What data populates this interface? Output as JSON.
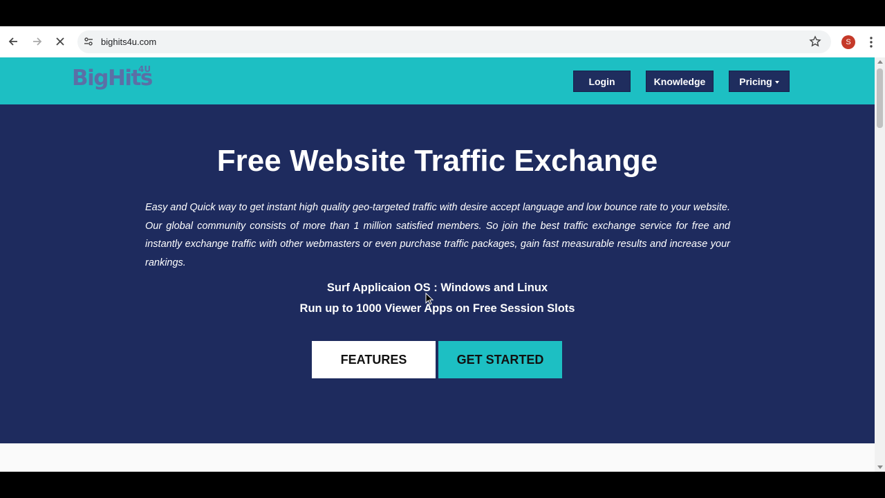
{
  "browser": {
    "url": "bighits4u.com",
    "avatar_letter": "S",
    "avatar_color": "#c53929"
  },
  "site": {
    "logo_text": "BigHits",
    "logo_suffix": "4U",
    "nav": {
      "login": "Login",
      "knowledge": "Knowledge",
      "pricing": "Pricing"
    }
  },
  "hero": {
    "title": "Free Website Traffic Exchange",
    "description": "Easy and Quick way to get instant high quality geo-targeted traffic with desire accept language and low bounce rate to your website. Our global community consists of more than 1 million satisfied members. So join the best traffic exchange service for free and instantly exchange traffic with other webmasters or even purchase traffic packages, gain fast measurable results and increase your rankings.",
    "line1": "Surf Applicaion OS : Windows and Linux",
    "line2": "Run up to 1000 Viewer Apps on Free Session Slots",
    "features_button": "FEATURES",
    "get_started_button": "GET STARTED"
  },
  "colors": {
    "header_bg": "#1dbfc3",
    "hero_bg": "#1e2b5e",
    "button_dark": "#1f2d5e",
    "accent": "#1dbfc3"
  }
}
